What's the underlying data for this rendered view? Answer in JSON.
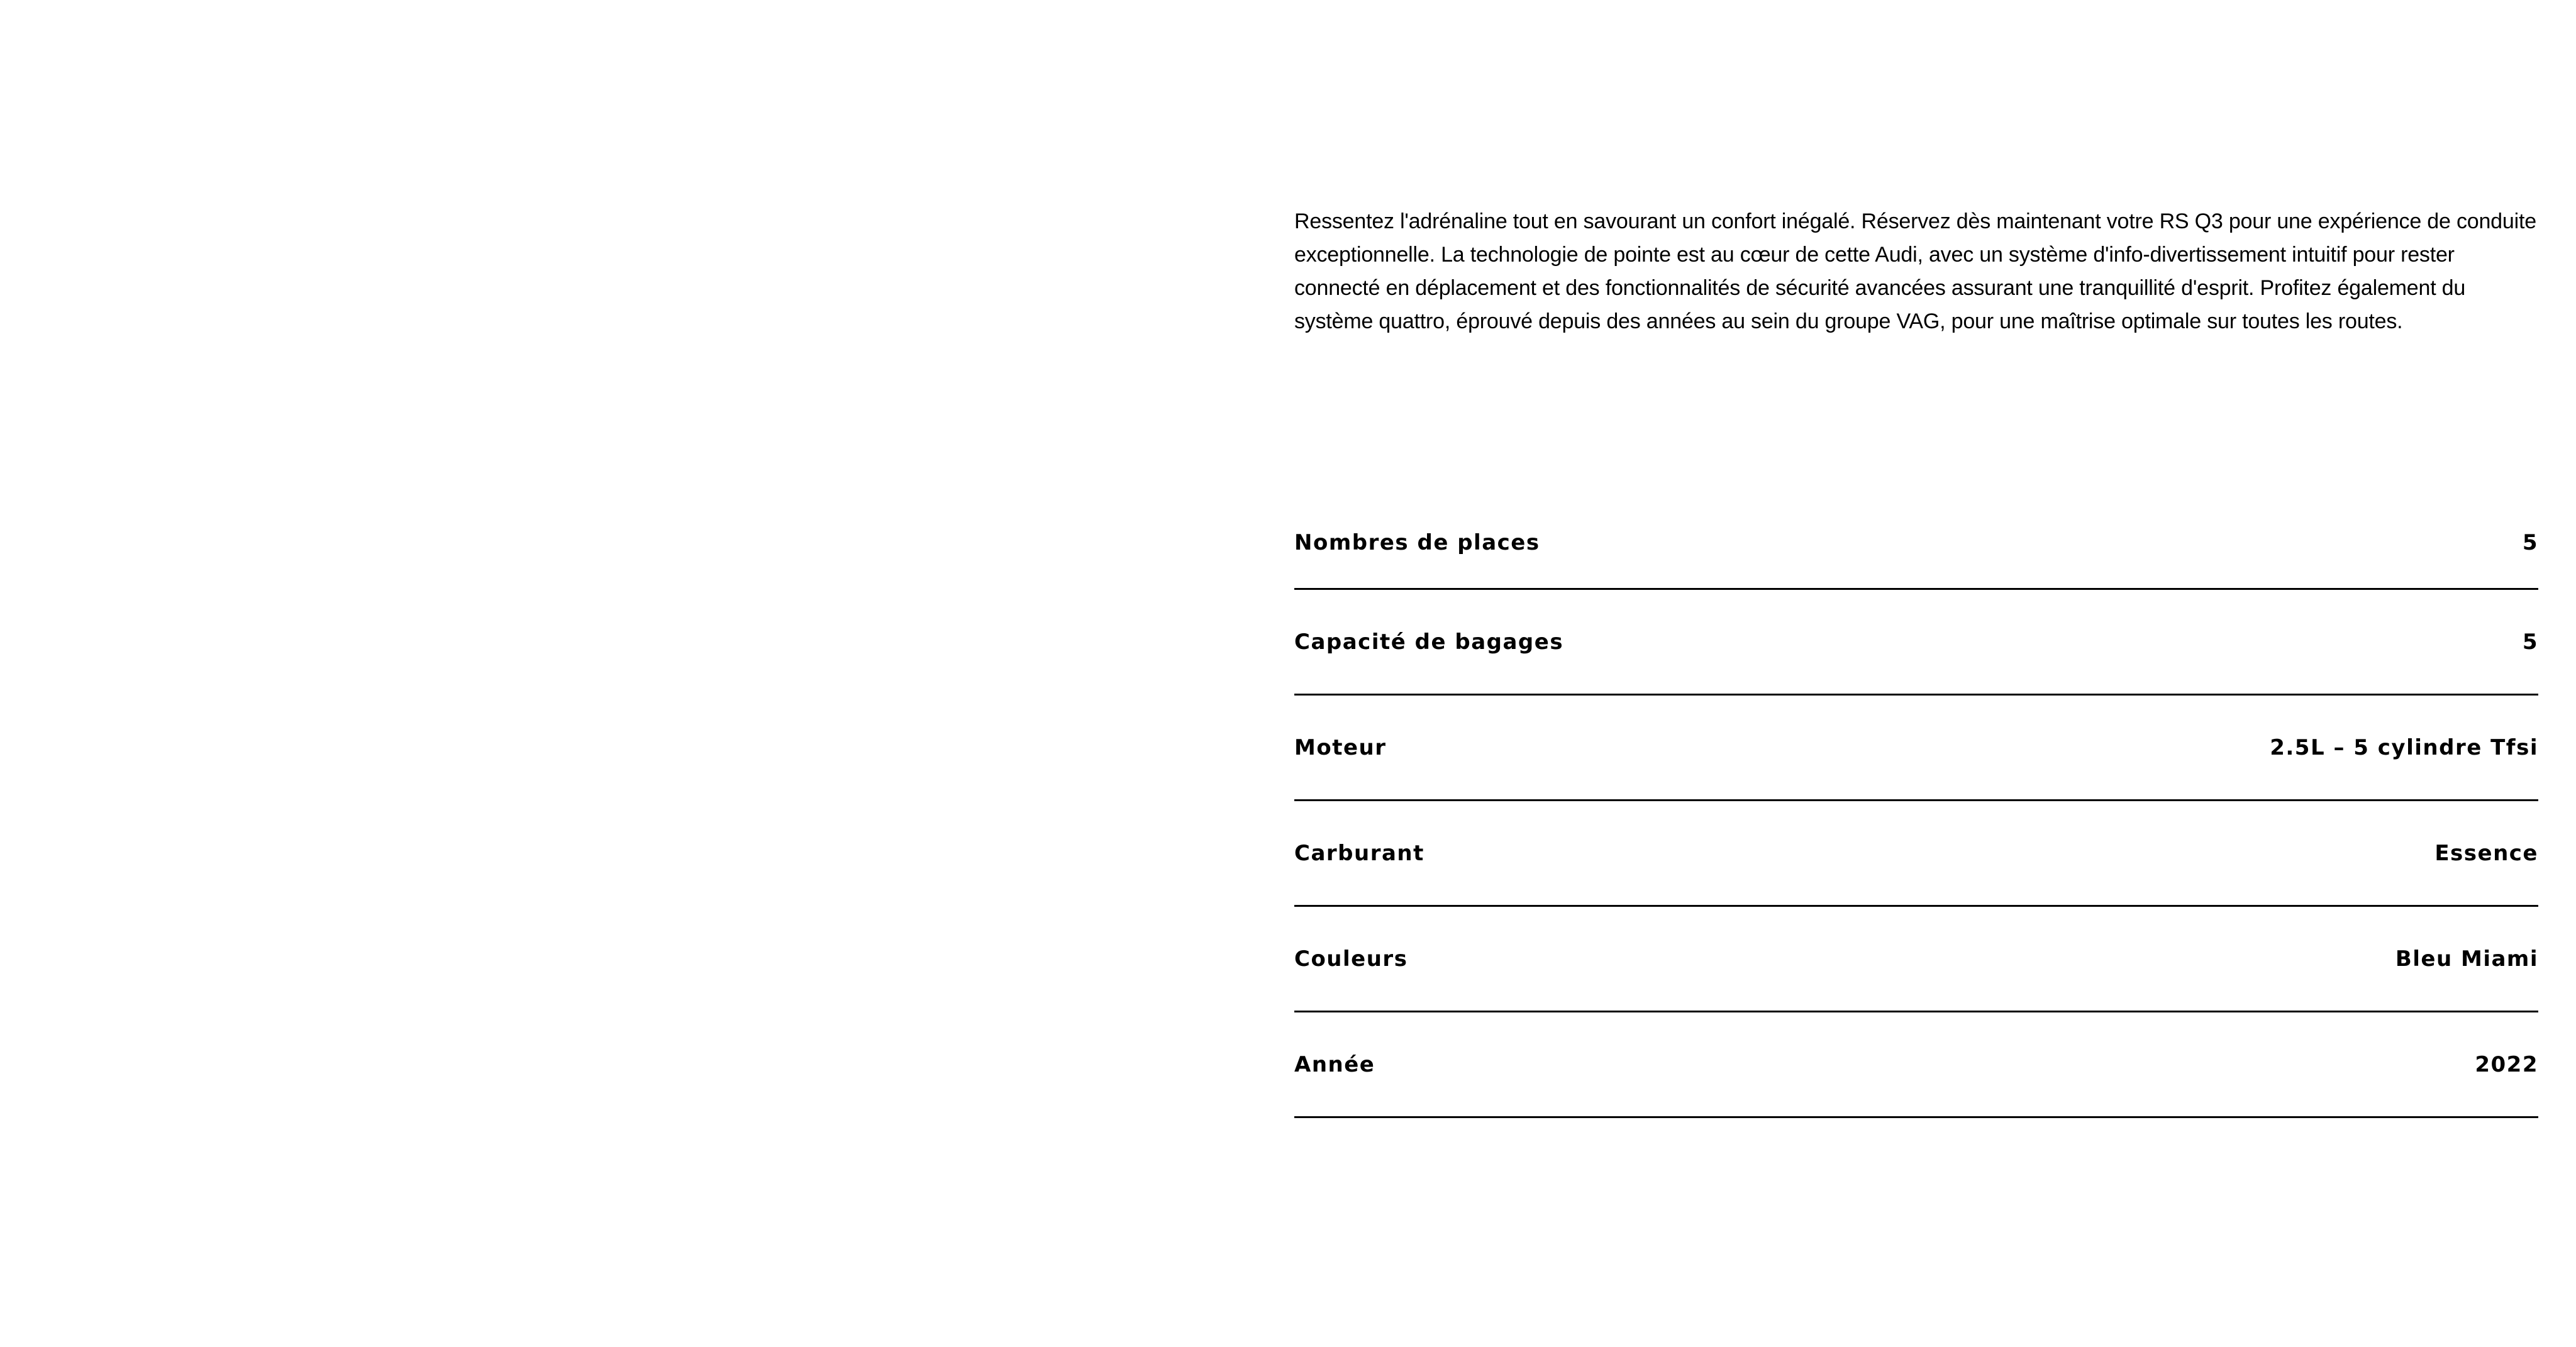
{
  "description": "Ressentez l'adrénaline tout en savourant un confort inégalé. Réservez dès maintenant votre RS Q3 pour une expérience de conduite exceptionnelle. La technologie de pointe est au cœur de cette Audi, avec un système d'info-divertissement intuitif pour rester connecté en déplacement et des fonctionnalités de sécurité avancées assurant une tranquillité d'esprit. Profitez également du système quattro, éprouvé depuis des années au sein du groupe VAG, pour une maîtrise optimale sur toutes les routes.",
  "specs": [
    {
      "label": "Nombres de places",
      "value": "5"
    },
    {
      "label": "Capacité de bagages",
      "value": "5"
    },
    {
      "label": "Moteur",
      "value": "2.5L – 5 cylindre Tfsi"
    },
    {
      "label": "Carburant",
      "value": "Essence"
    },
    {
      "label": "Couleurs",
      "value": "Bleu Miami"
    },
    {
      "label": "Année",
      "value": "2022"
    }
  ]
}
